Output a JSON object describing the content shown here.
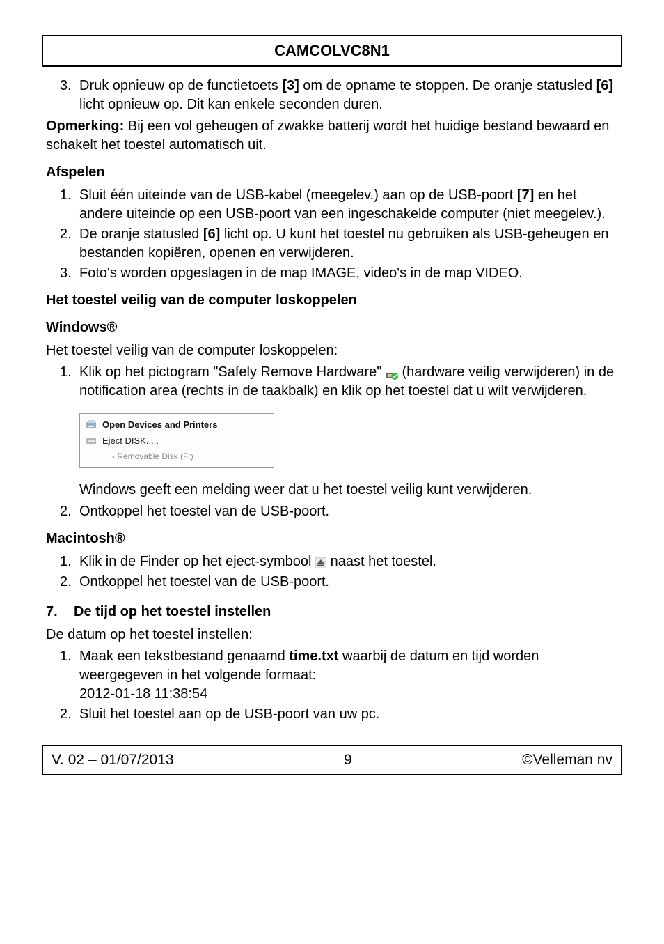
{
  "header": {
    "title": "CAMCOLVC8N1"
  },
  "stop_item": {
    "num": "3.",
    "pre": "Druk opnieuw op de functietoets ",
    "key": "[3]",
    "mid": " om de opname te stoppen. De oranje statusled ",
    "led": "[6]",
    "post": " licht opnieuw op. Dit kan enkele seconden duren."
  },
  "note": {
    "label": "Opmerking:",
    "text": " Bij een vol geheugen of zwakke batterij wordt het huidige bestand bewaard en schakelt het toestel automatisch uit."
  },
  "afspelen": {
    "title": "Afspelen",
    "i1": {
      "num": "1.",
      "pre": "Sluit één uiteinde van de USB-kabel (meegelev.) aan op de USB-poort ",
      "key": "[7]",
      "post": "  en het andere uiteinde op een USB-poort van een ingeschakelde computer (niet meegelev.)."
    },
    "i2": {
      "num": "2.",
      "pre": "De oranje statusled ",
      "led": "[6]",
      "post": " licht op. U kunt het toestel nu gebruiken als USB-geheugen en bestanden kopiëren, openen en verwijderen."
    },
    "i3": {
      "num": "3.",
      "text": "Foto's worden opgeslagen in de map IMAGE, video's in de map VIDEO."
    }
  },
  "loskoppelen": {
    "title": "Het toestel veilig van de computer loskoppelen"
  },
  "windows": {
    "title": "Windows®",
    "intro": "Het toestel veilig van de computer loskoppelen:",
    "i1": {
      "num": "1.",
      "pre": "Klik op het pictogram \"Safely Remove Hardware\" ",
      "post": " (hardware veilig verwijderen) in de notification area (rechts in de taakbalk) en klik op het toestel dat u wilt verwijderen."
    },
    "menu": {
      "open": "Open Devices and Printers",
      "eject": "Eject DISK.....",
      "removable": "Removable Disk (F:)"
    },
    "confirm": "Windows geeft een melding weer dat u het toestel veilig kunt verwijderen.",
    "i2": {
      "num": "2.",
      "text": "Ontkoppel het toestel van de USB-poort."
    }
  },
  "mac": {
    "title": "Macintosh®",
    "i1": {
      "num": "1.",
      "pre": "Klik in de Finder op het eject-symbool ",
      "post": " naast het toestel."
    },
    "i2": {
      "num": "2.",
      "text": "Ontkoppel het toestel van de USB-poort."
    }
  },
  "tijd": {
    "num": "7.",
    "title": "De tijd op het toestel instellen",
    "intro": "De datum op het toestel instellen:",
    "i1": {
      "num": "1.",
      "pre": "Maak een tekstbestand genaamd ",
      "fname": "time.txt",
      "post": " waarbij de datum en tijd worden weergegeven in het volgende formaat:",
      "example": "2012-01-18 11:38:54"
    },
    "i2": {
      "num": "2.",
      "text": "Sluit het toestel aan op de USB-poort van uw pc."
    }
  },
  "footer": {
    "version": "V. 02 – 01/07/2013",
    "page": "9",
    "copyright": "©Velleman nv"
  }
}
